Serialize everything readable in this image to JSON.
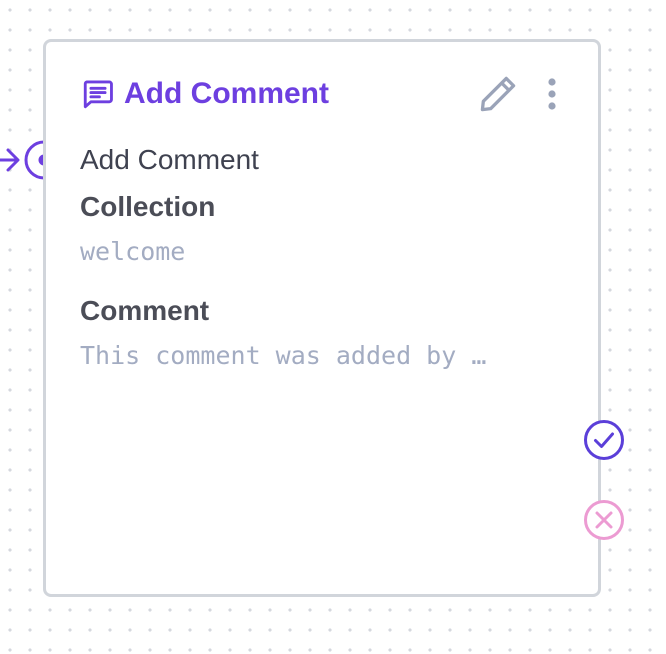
{
  "node": {
    "title": "Add Comment",
    "subtitle": "Add Comment",
    "header_icon": "comment-icon",
    "actions": {
      "edit_icon": "pencil-icon",
      "more_icon": "more-vertical-icon"
    },
    "fields": [
      {
        "label": "Collection",
        "value": "welcome"
      },
      {
        "label": "Comment",
        "value": "This comment was added by …"
      }
    ],
    "handles": {
      "input": "target-handle-icon",
      "success": "check-circle-icon",
      "failure": "x-circle-icon"
    }
  },
  "colors": {
    "accent": "#6d3fe0",
    "success": "#5b3fd9",
    "failure": "#ec9bd2",
    "border": "#d1d5db",
    "muted_value": "#a3acc2",
    "icon_gray": "#9aa3b8"
  }
}
